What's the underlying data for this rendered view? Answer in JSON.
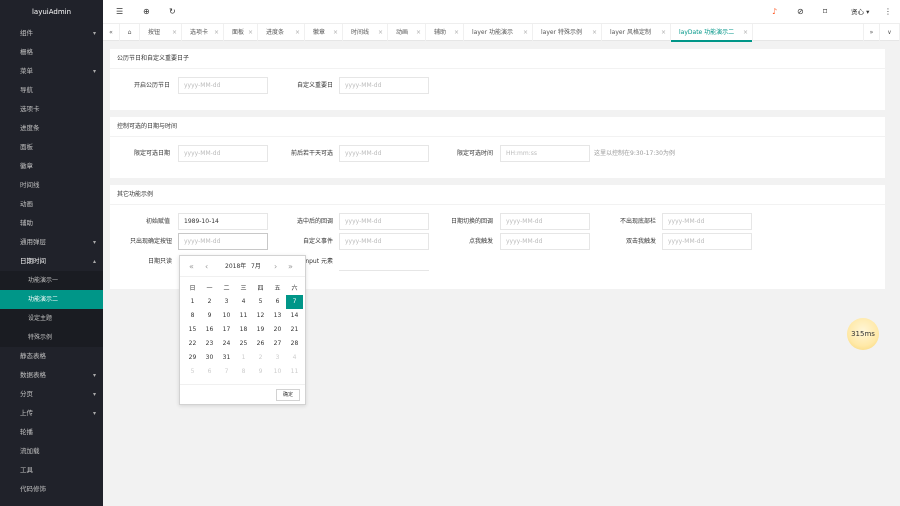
{
  "app": {
    "title": "layuiAdmin"
  },
  "sidebar": {
    "items": [
      {
        "label": "组件",
        "arrow": "▾"
      },
      {
        "label": "栅格",
        "arrow": ""
      },
      {
        "label": "菜单",
        "arrow": "▾"
      },
      {
        "label": "导航",
        "arrow": ""
      },
      {
        "label": "选项卡",
        "arrow": ""
      },
      {
        "label": "进度条",
        "arrow": ""
      },
      {
        "label": "面板",
        "arrow": ""
      },
      {
        "label": "徽章",
        "arrow": ""
      },
      {
        "label": "时间线",
        "arrow": ""
      },
      {
        "label": "动画",
        "arrow": ""
      },
      {
        "label": "辅助",
        "arrow": ""
      },
      {
        "label": "通用弹层",
        "arrow": "▾"
      },
      {
        "label": "日期时间",
        "arrow": "▴"
      }
    ],
    "subitems": [
      {
        "label": "功能演示一"
      },
      {
        "label": "功能演示二"
      },
      {
        "label": "设定主题"
      },
      {
        "label": "特殊示例"
      }
    ],
    "items2": [
      {
        "label": "静态表格",
        "arrow": ""
      },
      {
        "label": "数据表格",
        "arrow": "▾"
      },
      {
        "label": "分页",
        "arrow": "▾"
      },
      {
        "label": "上传",
        "arrow": "▾"
      },
      {
        "label": "轮播",
        "arrow": ""
      },
      {
        "label": "流加载",
        "arrow": ""
      },
      {
        "label": "工具",
        "arrow": ""
      },
      {
        "label": "代码修饰",
        "arrow": ""
      }
    ]
  },
  "topbar": {
    "menu_icon": "☰",
    "home_icon": "⊕",
    "refresh_icon": "↻",
    "bell_icon": "♪",
    "theme_icon": "⊘",
    "tag_icon": "⌑",
    "user_label": "贤心",
    "user_arrow": "▾",
    "more_icon": "⋮"
  },
  "tabs": {
    "prev": "«",
    "home": "⌂",
    "next": "»",
    "down": "∨",
    "close": "×",
    "items": [
      {
        "label": "按钮"
      },
      {
        "label": "选项卡"
      },
      {
        "label": "面板"
      },
      {
        "label": "进度条"
      },
      {
        "label": "徽章"
      },
      {
        "label": "时间线"
      },
      {
        "label": "动画"
      },
      {
        "label": "辅助"
      },
      {
        "label": "layer 功能演示"
      },
      {
        "label": "layer 特殊示例"
      },
      {
        "label": "layer 风格定制"
      },
      {
        "label": "layDate 功能演示二"
      }
    ]
  },
  "section1": {
    "title": "公历节日和自定义重要日子",
    "f1_label": "开启公历节日",
    "f1_placeholder": "yyyy-MM-dd",
    "f2_label": "自定义重要日",
    "f2_placeholder": "yyyy-MM-dd"
  },
  "section2": {
    "title": "控制可选的日期与时间",
    "f1_label": "限定可选日期",
    "f1_placeholder": "yyyy-MM-dd",
    "f2_label": "前后若干天可选",
    "f2_placeholder": "yyyy-MM-dd",
    "f3_label": "限定可选时间",
    "f3_placeholder": "HH:mm:ss",
    "note": "这里以控制在9:30-17:30为例"
  },
  "section3": {
    "title": "其它功能示例",
    "r1": [
      {
        "label": "初始赋值",
        "value": "1989-10-14"
      },
      {
        "label": "选中后的回调",
        "placeholder": "yyyy-MM-dd"
      },
      {
        "label": "日期切换的回调",
        "placeholder": "yyyy-MM-dd"
      },
      {
        "label": "不出现底部栏",
        "placeholder": "yyyy-MM-dd"
      }
    ],
    "r2": [
      {
        "label": "只出现确定按钮",
        "placeholder": "yyyy-MM-dd"
      },
      {
        "label": "自定义事件",
        "placeholder": "yyyy-MM-dd"
      },
      {
        "label": "点我触发",
        "placeholder": "yyyy-MM-dd"
      },
      {
        "label": "双击我触发",
        "placeholder": "yyyy-MM-dd"
      }
    ],
    "r3": [
      {
        "label": "日期只读"
      },
      {
        "label": "非 input 元素"
      }
    ]
  },
  "calendar": {
    "prev_year": "«",
    "prev_month": "‹",
    "next_month": "›",
    "next_year": "»",
    "year": "2018年",
    "month": "7月",
    "weekdays": [
      "日",
      "一",
      "二",
      "三",
      "四",
      "五",
      "六"
    ],
    "days": [
      [
        "1",
        "2",
        "3",
        "4",
        "5",
        "6",
        "7"
      ],
      [
        "8",
        "9",
        "10",
        "11",
        "12",
        "13",
        "14"
      ],
      [
        "15",
        "16",
        "17",
        "18",
        "19",
        "20",
        "21"
      ],
      [
        "22",
        "23",
        "24",
        "25",
        "26",
        "27",
        "28"
      ],
      [
        "29",
        "30",
        "31",
        "1",
        "2",
        "3",
        "4"
      ],
      [
        "5",
        "6",
        "7",
        "8",
        "9",
        "10",
        "11"
      ]
    ],
    "selected": "7",
    "ok_label": "确定"
  },
  "speed_badge": {
    "label": "315ms"
  }
}
